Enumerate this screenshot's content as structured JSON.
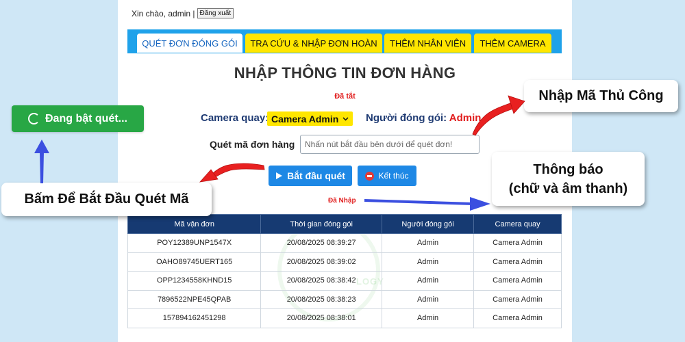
{
  "header": {
    "greeting": "Xin chào, admin |",
    "logout_label": "Đăng xuất"
  },
  "tabs": [
    {
      "label": "QUÉT ĐƠN ĐÓNG GÓI",
      "active": true
    },
    {
      "label": "TRA CỨU & NHẬP ĐƠN HOÀN",
      "active": false
    },
    {
      "label": "THÊM NHÂN VIÊN",
      "active": false
    },
    {
      "label": "THÊM CAMERA",
      "active": false
    }
  ],
  "main": {
    "title": "NHẬP THÔNG TIN ĐƠN HÀNG",
    "camera_status": "Đã tắt",
    "camera_label": "Camera quay:",
    "camera_selected": "Camera Admin",
    "packer_label": "Người đóng gói:",
    "packer_value": "Admin",
    "scan_label": "Quét mã đơn hàng",
    "scan_placeholder": "Nhấn nút bắt đầu bên dưới để quét đơn!",
    "start_label": "Bắt đầu quét",
    "stop_label": "Kết thúc",
    "imported_status": "Đã Nhập"
  },
  "table": {
    "headers": [
      "Mã vận đơn",
      "Thời gian đóng gói",
      "Người đóng gói",
      "Camera quay"
    ],
    "rows": [
      [
        "POY12389UNP1547X",
        "20/08/2025 08:39:27",
        "Admin",
        "Camera Admin"
      ],
      [
        "OAHO89745UERT165",
        "20/08/2025 08:39:02",
        "Admin",
        "Camera Admin"
      ],
      [
        "OPP1234558KHND15",
        "20/08/2025 08:38:42",
        "Admin",
        "Camera Admin"
      ],
      [
        "7896522NPE45QPAB",
        "20/08/2025 08:38:23",
        "Admin",
        "Camera Admin"
      ],
      [
        "157894162451298",
        "20/08/2025 08:38:01",
        "Admin",
        "Camera Admin"
      ]
    ]
  },
  "watermark": "LOGY",
  "annotations": {
    "scanning_button": "Đang bật quét...",
    "manual_entry": "Nhập Mã Thủ Công",
    "notify_line1": "Thông báo",
    "notify_line2": "(chữ và âm thanh)",
    "start_hint": "Bấm Để Bắt Đầu Quét Mã"
  },
  "colors": {
    "accent_blue": "#1e88e5",
    "tab_yellow": "#ffe600",
    "header_navy": "#163a72",
    "alert_red": "#e11d1d",
    "success_green": "#28a745",
    "arrow_red": "#e82020",
    "arrow_blue": "#3b4fe0"
  }
}
